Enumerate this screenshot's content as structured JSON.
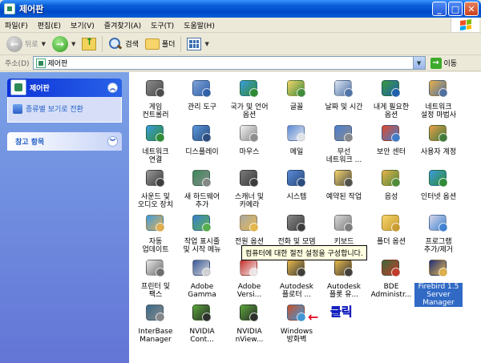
{
  "window": {
    "title": "제어판",
    "buttons": [
      "_",
      "□",
      "✕"
    ]
  },
  "menubar": {
    "items": [
      "파일(F)",
      "편집(E)",
      "보기(V)",
      "즐겨찾기(A)",
      "도구(T)",
      "도움말(H)"
    ]
  },
  "toolbar": {
    "back_label": "뒤로",
    "search_label": "검색",
    "folders_label": "폴더"
  },
  "address": {
    "label": "주소(D)",
    "value": "제어판",
    "go_label": "이동"
  },
  "left_panel": {
    "control_panel_header": "제어판",
    "switch_view_link": "종류별 보기로 전환",
    "see_also_header": "참고 항목"
  },
  "items": [
    {
      "label": "게임\n컨트롤러",
      "icon": "gamepad-icon"
    },
    {
      "label": "관리 도구",
      "icon": "admin-tools-icon"
    },
    {
      "label": "국가 및 언어\n옵션",
      "icon": "globe-icon"
    },
    {
      "label": "글꼴",
      "icon": "fonts-folder-icon"
    },
    {
      "label": "날짜 및 시간",
      "icon": "clock-icon"
    },
    {
      "label": "내게 필요한\n옵션",
      "icon": "accessibility-icon"
    },
    {
      "label": "네트워크\n설정 마법사",
      "icon": "network-wizard-icon"
    },
    {
      "label": "네트워크\n연결",
      "icon": "network-icon"
    },
    {
      "label": "디스플레이",
      "icon": "display-icon"
    },
    {
      "label": "마우스",
      "icon": "mouse-icon"
    },
    {
      "label": "메일",
      "icon": "mail-icon"
    },
    {
      "label": "무선\n네트워크 ...",
      "icon": "wireless-icon"
    },
    {
      "label": "보안 센터",
      "icon": "security-shield-icon"
    },
    {
      "label": "사용자 계정",
      "icon": "users-icon"
    },
    {
      "label": "사운드 및\n오디오 장치",
      "icon": "speaker-icon"
    },
    {
      "label": "새 하드웨어\n추가",
      "icon": "hardware-icon"
    },
    {
      "label": "스캐너 및\n카메라",
      "icon": "scanner-icon"
    },
    {
      "label": "시스템",
      "icon": "system-icon"
    },
    {
      "label": "예약된 작업",
      "icon": "scheduled-tasks-icon"
    },
    {
      "label": "음성",
      "icon": "speech-icon"
    },
    {
      "label": "인터넷 옵션",
      "icon": "internet-icon"
    },
    {
      "label": "자동\n업데이트",
      "icon": "update-icon"
    },
    {
      "label": "작업 표시줄\n및 시작 메뉴",
      "icon": "taskbar-icon"
    },
    {
      "label": "전원 옵션",
      "icon": "power-icon"
    },
    {
      "label": "전화 및 모뎀\n옵션",
      "icon": "phone-icon"
    },
    {
      "label": "키보드",
      "icon": "keyboard-icon"
    },
    {
      "label": "폴더 옵션",
      "icon": "folder-options-icon"
    },
    {
      "label": "프로그램\n추가/제거",
      "icon": "add-remove-icon"
    },
    {
      "label": "프린터 및\n팩스",
      "icon": "printer-icon"
    },
    {
      "label": "Adobe\nGamma",
      "icon": "monitor-icon"
    },
    {
      "label": "Adobe\nVersi...",
      "icon": "adobe-icon"
    },
    {
      "label": "Autodesk\n플로터 ...",
      "icon": "autodesk-plotter-icon"
    },
    {
      "label": "Autodesk\n플롯 유...",
      "icon": "autodesk-plot-icon"
    },
    {
      "label": "BDE\nAdministr...",
      "icon": "bde-icon"
    },
    {
      "label": "Firebird 1.5\nServer\nManager",
      "icon": "firebird-icon"
    },
    {
      "label": "InterBase\nManager",
      "icon": "interbase-icon"
    },
    {
      "label": "NVIDIA\nCont...",
      "icon": "nvidia-icon"
    },
    {
      "label": "NVIDIA\nnView...",
      "icon": "nvidia-nview-icon"
    },
    {
      "label": "Windows\n방화벽",
      "icon": "firewall-icon"
    }
  ],
  "tooltip": "컴퓨터에 대한 절전 설정을 구성합니다.",
  "annotation": {
    "arrow": "←",
    "text": "클릭"
  },
  "colors": {
    "titlebar": "#0A5FD8",
    "leftpanel": "#7BA2E7",
    "selection": "#316AC5",
    "annotation": "#E8112B"
  }
}
